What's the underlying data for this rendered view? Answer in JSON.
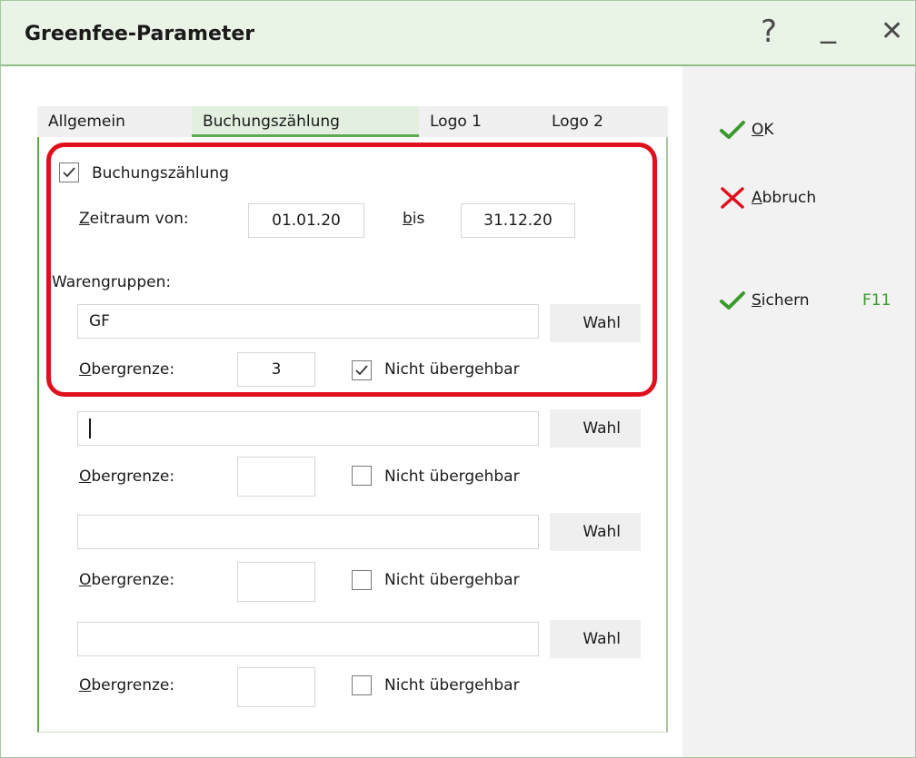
{
  "window": {
    "title": "Greenfee-Parameter",
    "help_glyph": "?",
    "minimize_glyph": "_",
    "close_glyph": "✕"
  },
  "tabs": [
    {
      "label": "Allgemein",
      "active": false
    },
    {
      "label": "Buchungszählung",
      "active": true
    },
    {
      "label": "Logo 1",
      "active": false
    },
    {
      "label": "Logo 2",
      "active": false
    }
  ],
  "form": {
    "booking_count": {
      "label": "Buchungszählung",
      "checked": true
    },
    "period": {
      "from_label_u": "Z",
      "from_label_rest": "eitraum von:",
      "from_value": "01.01.20",
      "to_label_u": "b",
      "to_label_rest": "is",
      "to_value": "31.12.20"
    },
    "product_groups_label": "Warengruppen:",
    "groups": [
      {
        "value": "GF",
        "choose": "Wahl",
        "limit_u": "O",
        "limit_rest": "bergrenze:",
        "limit_value": "3",
        "not_transferable": "Nicht übergehbar",
        "checked": true
      },
      {
        "value": "",
        "choose": "Wahl",
        "limit_u": "O",
        "limit_rest": "bergrenze:",
        "limit_value": "",
        "not_transferable": "Nicht übergehbar",
        "checked": false
      },
      {
        "value": "",
        "choose": "Wahl",
        "limit_u": "O",
        "limit_rest": "bergrenze:",
        "limit_value": "",
        "not_transferable": "Nicht übergehbar",
        "checked": false
      },
      {
        "value": "",
        "choose": "Wahl",
        "limit_u": "O",
        "limit_rest": "bergrenze:",
        "limit_value": "",
        "not_transferable": "Nicht übergehbar",
        "checked": false
      }
    ]
  },
  "actions": {
    "ok_u": "O",
    "ok_rest": "K",
    "cancel_u": "A",
    "cancel_rest": "bbruch",
    "save_u": "S",
    "save_rest": "ichern",
    "save_shortcut": "F11"
  },
  "colors": {
    "accent_green": "#5daa4f",
    "highlight_red": "#e0101e",
    "cancel_red": "#e0101e"
  }
}
